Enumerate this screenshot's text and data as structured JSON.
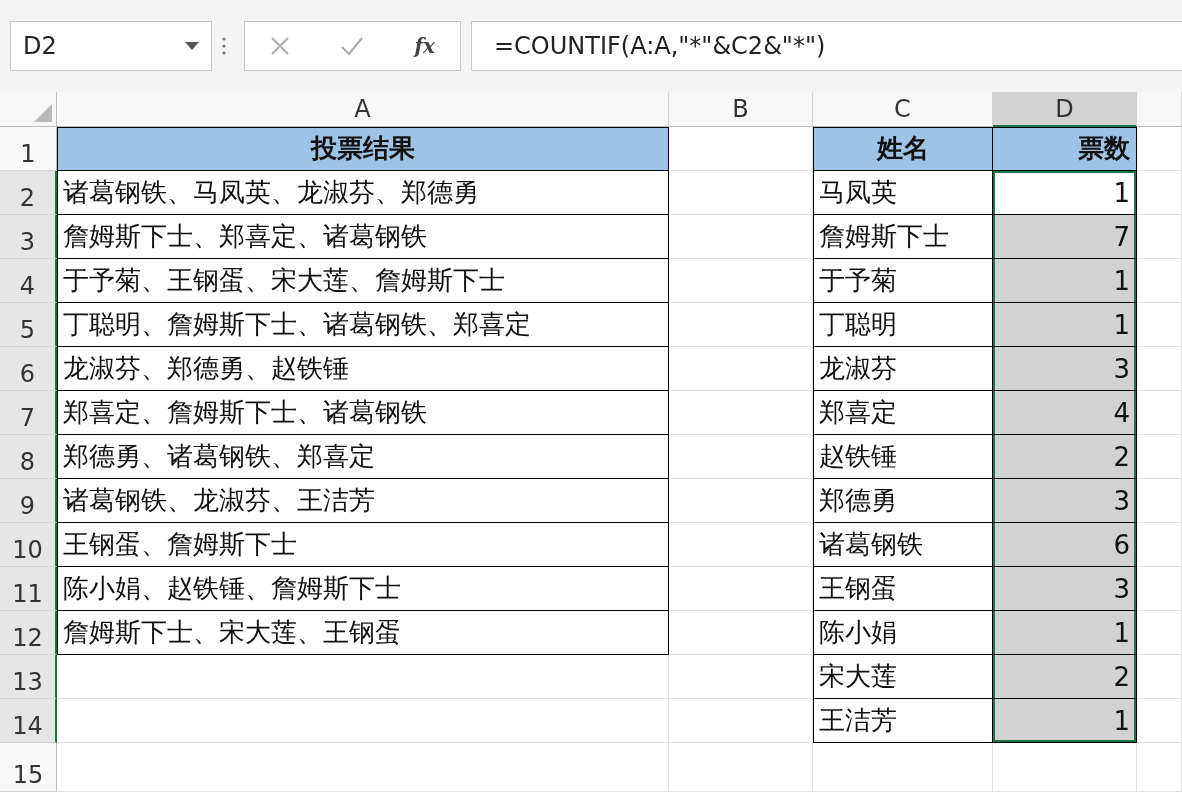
{
  "formula_bar": {
    "name_box": "D2",
    "function_label": "fx",
    "formula": "=COUNTIF(A:A,\"*\"&C2&\"*\")"
  },
  "columns": [
    {
      "label": "A",
      "selected": false
    },
    {
      "label": "B",
      "selected": false
    },
    {
      "label": "C",
      "selected": false
    },
    {
      "label": "D",
      "selected": true
    }
  ],
  "rows": [
    {
      "number": "1",
      "kind": "header",
      "selected": false,
      "a": "投票结果",
      "c": "姓名",
      "d": "票数"
    },
    {
      "number": "2",
      "kind": "data",
      "selected": true,
      "active": true,
      "a": "诸葛钢铁、马凤英、龙淑芬、郑德勇",
      "c": "马凤英",
      "d": "1"
    },
    {
      "number": "3",
      "kind": "data",
      "selected": true,
      "active": false,
      "a": "詹姆斯下士、郑喜定、诸葛钢铁",
      "c": "詹姆斯下士",
      "d": "7"
    },
    {
      "number": "4",
      "kind": "data",
      "selected": true,
      "active": false,
      "a": "于予菊、王钢蛋、宋大莲、詹姆斯下士",
      "c": "于予菊",
      "d": "1"
    },
    {
      "number": "5",
      "kind": "data",
      "selected": true,
      "active": false,
      "a": "丁聪明、詹姆斯下士、诸葛钢铁、郑喜定",
      "c": "丁聪明",
      "d": "1"
    },
    {
      "number": "6",
      "kind": "data",
      "selected": true,
      "active": false,
      "a": "龙淑芬、郑德勇、赵铁锤",
      "c": "龙淑芬",
      "d": "3"
    },
    {
      "number": "7",
      "kind": "data",
      "selected": true,
      "active": false,
      "a": "郑喜定、詹姆斯下士、诸葛钢铁",
      "c": "郑喜定",
      "d": "4"
    },
    {
      "number": "8",
      "kind": "data",
      "selected": true,
      "active": false,
      "a": "郑德勇、诸葛钢铁、郑喜定",
      "c": "赵铁锤",
      "d": "2"
    },
    {
      "number": "9",
      "kind": "data",
      "selected": true,
      "active": false,
      "a": "诸葛钢铁、龙淑芬、王洁芳",
      "c": "郑德勇",
      "d": "3"
    },
    {
      "number": "10",
      "kind": "data",
      "selected": true,
      "active": false,
      "a": "王钢蛋、詹姆斯下士",
      "c": "诸葛钢铁",
      "d": "6"
    },
    {
      "number": "11",
      "kind": "data",
      "selected": true,
      "active": false,
      "a": "陈小娟、赵铁锤、詹姆斯下士",
      "c": "王钢蛋",
      "d": "3"
    },
    {
      "number": "12",
      "kind": "data",
      "selected": true,
      "active": false,
      "a": "詹姆斯下士、宋大莲、王钢蛋",
      "c": "陈小娟",
      "d": "1"
    },
    {
      "number": "13",
      "kind": "data",
      "selected": true,
      "active": false,
      "c": "宋大莲",
      "d": "2"
    },
    {
      "number": "14",
      "kind": "data",
      "selected": true,
      "active": false,
      "c": "王洁芳",
      "d": "1"
    },
    {
      "number": "15",
      "kind": "data",
      "selected": false
    }
  ]
}
